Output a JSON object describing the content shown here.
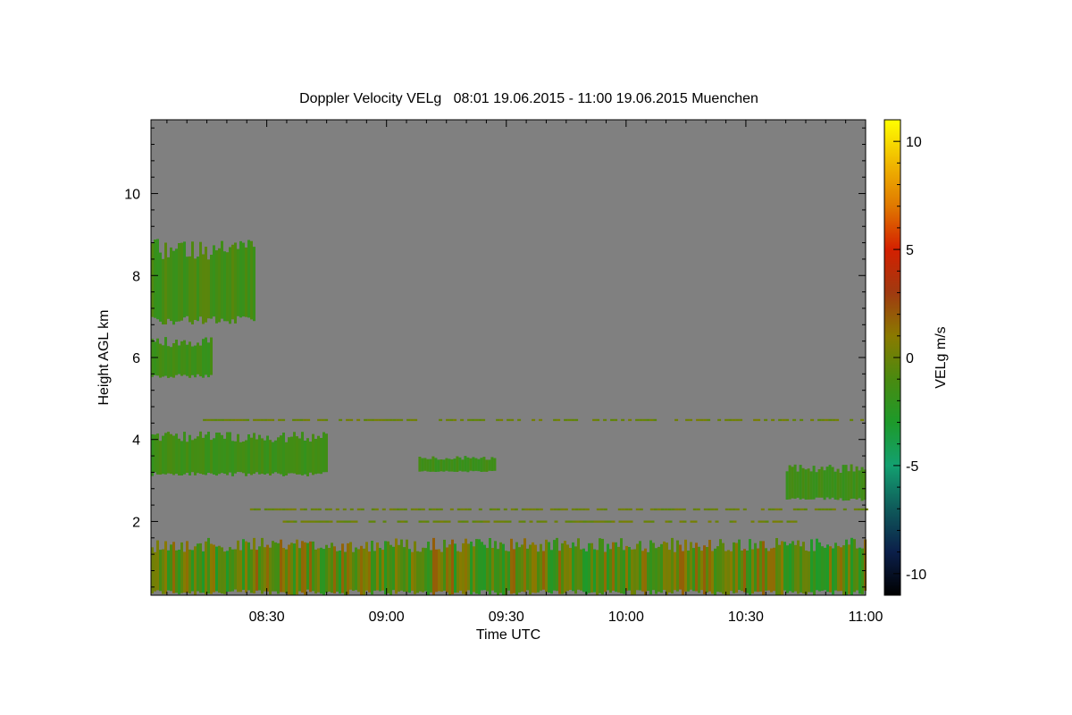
{
  "chart_data": {
    "type": "heatmap",
    "title": "Doppler Velocity VELg   08:01 19.06.2015 - 11:00 19.06.2015 Muenchen",
    "xlabel": "Time UTC",
    "ylabel": "Height AGL km",
    "colorbar_label": "VELg m/s",
    "x_range": [
      "08:01",
      "11:00"
    ],
    "x_ticks": [
      "08:30",
      "09:00",
      "09:30",
      "10:00",
      "10:30",
      "11:00"
    ],
    "y_range": [
      0.2,
      11.8
    ],
    "y_ticks": [
      2,
      4,
      6,
      8,
      10
    ],
    "colorbar_range": [
      -11,
      11
    ],
    "colorbar_ticks": [
      10,
      5,
      0,
      -5,
      -10
    ],
    "background_color": "#808080",
    "colorscale": [
      "#000000",
      "#0b1f4a",
      "#0f5a5a",
      "#13a070",
      "#1d9a2a",
      "#4a8a10",
      "#8a7a00",
      "#a03a10",
      "#d42000",
      "#e07800",
      "#f0b800",
      "#ffff00"
    ],
    "features": [
      {
        "name": "boundary layer echoes",
        "time": [
          "08:01",
          "11:00"
        ],
        "height_km": [
          0.2,
          1.6
        ],
        "velocity": [
          -3,
          2
        ]
      },
      {
        "name": "cloud layer",
        "time": [
          "08:01",
          "08:45"
        ],
        "height_km": [
          3.1,
          4.2
        ],
        "velocity": [
          -2,
          -1
        ]
      },
      {
        "name": "cloud layer",
        "time": [
          "09:08",
          "09:27"
        ],
        "height_km": [
          3.2,
          3.6
        ],
        "velocity": [
          -2,
          -1
        ]
      },
      {
        "name": "cloud layer",
        "time": [
          "10:40",
          "11:00"
        ],
        "height_km": [
          2.5,
          3.4
        ],
        "velocity": [
          -2,
          -1
        ]
      },
      {
        "name": "cloud layer",
        "time": [
          "08:01",
          "08:16"
        ],
        "height_km": [
          5.5,
          6.5
        ],
        "velocity": [
          -2,
          -1
        ]
      },
      {
        "name": "cloud layer",
        "time": [
          "08:01",
          "08:27"
        ],
        "height_km": [
          6.8,
          8.9
        ],
        "velocity": [
          -2,
          -0.5
        ]
      },
      {
        "name": "thin layer",
        "time": [
          "08:14",
          "11:00"
        ],
        "height_km": [
          4.45,
          4.5
        ],
        "velocity": [
          -0.5,
          0.5
        ]
      },
      {
        "name": "thin layer",
        "time": [
          "08:24",
          "11:00"
        ],
        "height_km": [
          2.27,
          2.32
        ],
        "velocity": [
          -0.5,
          0.5
        ]
      },
      {
        "name": "thin layer",
        "time": [
          "08:34",
          "10:44"
        ],
        "height_km": [
          1.97,
          2.02
        ],
        "velocity": [
          -0.5,
          0.5
        ]
      }
    ]
  }
}
